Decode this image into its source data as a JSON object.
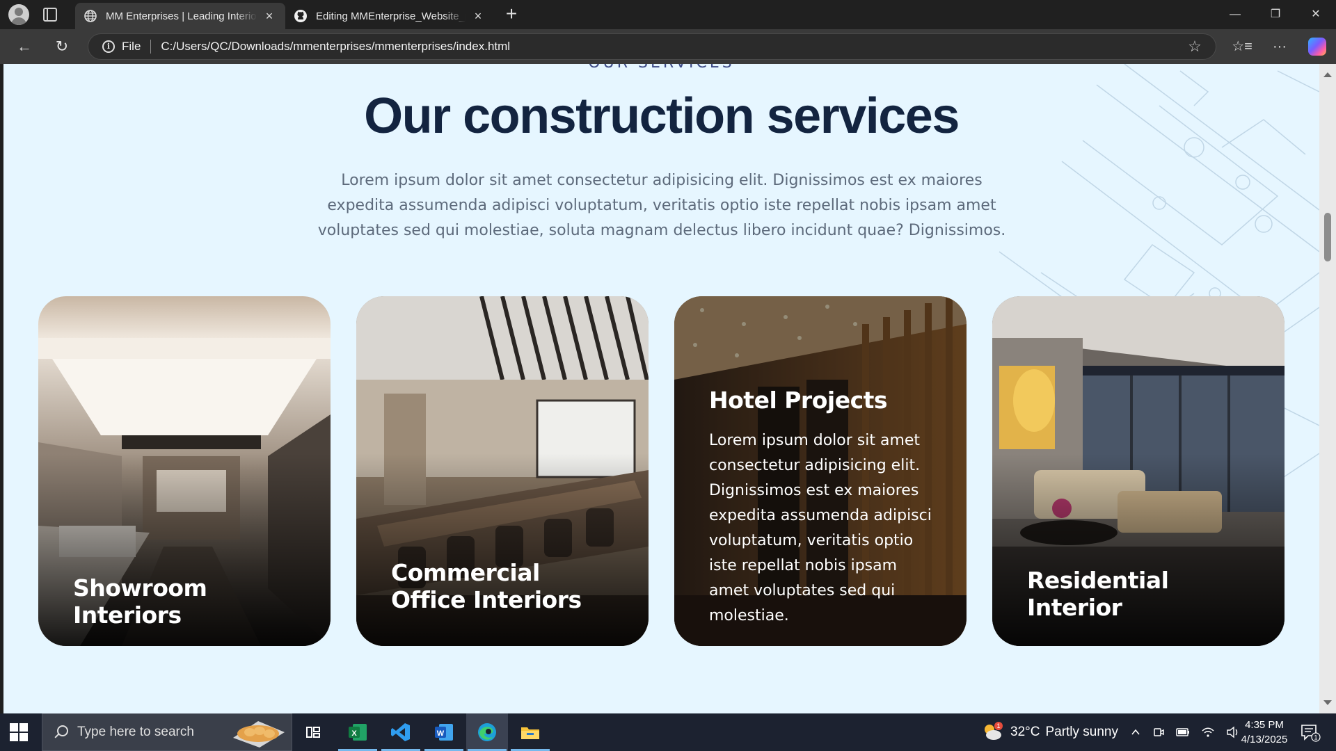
{
  "browser": {
    "tabs": [
      {
        "title": "MM Enterprises | Leading Interior",
        "icon": "globe-icon",
        "active": true
      },
      {
        "title": "Editing MMEnterprise_Website_pr",
        "icon": "github-icon",
        "active": false
      }
    ],
    "new_tab_label": "+",
    "address": {
      "scheme_label": "File",
      "url": "C:/Users/QC/Downloads/mmenterprises/mmenterprises/index.html"
    },
    "window_controls": {
      "minimize": "—",
      "restore": "❐",
      "close": "✕"
    },
    "nav": {
      "back": "←",
      "refresh": "↻"
    },
    "toolbar_icons": {
      "favorite": "☆",
      "favorites": "☆≡",
      "more": "···"
    }
  },
  "page": {
    "eyebrow": "OUR SERVICES",
    "title": "Our construction services",
    "description": "Lorem ipsum dolor sit amet consectetur adipisicing elit. Dignissimos est ex maiores expedita assumenda adipisci voluptatum, veritatis optio iste repellat nobis ipsam amet voluptates sed qui molestiae, soluta magnam delectus libero incidunt quae? Dignissimos.",
    "cards": [
      {
        "title": "Showroom Interiors",
        "text": ""
      },
      {
        "title": "Commercial Office Interiors",
        "text": ""
      },
      {
        "title": "Hotel Projects",
        "text": "Lorem ipsum dolor sit amet consectetur adipisicing elit. Dignissimos est ex maiores expedita assumenda adipisci voluptatum, veritatis optio iste repellat nobis ipsam amet voluptates sed qui molestiae."
      },
      {
        "title": "Residential Interior",
        "text": ""
      }
    ]
  },
  "taskbar": {
    "search_placeholder": "Type here to search",
    "apps": [
      "task-view-icon",
      "excel-icon",
      "vscode-icon",
      "word-icon",
      "edge-icon",
      "file-explorer-icon"
    ],
    "weather": {
      "temp": "32°C",
      "condition": "Partly sunny",
      "alert_count": "1"
    },
    "clock": {
      "time": "4:35 PM",
      "date": "4/13/2025"
    },
    "notification_count": "1"
  },
  "colors": {
    "page_bg": "#e6f6ff",
    "heading": "#132440",
    "body_text": "#5d6a7b",
    "eyebrow": "#3c4a86"
  }
}
